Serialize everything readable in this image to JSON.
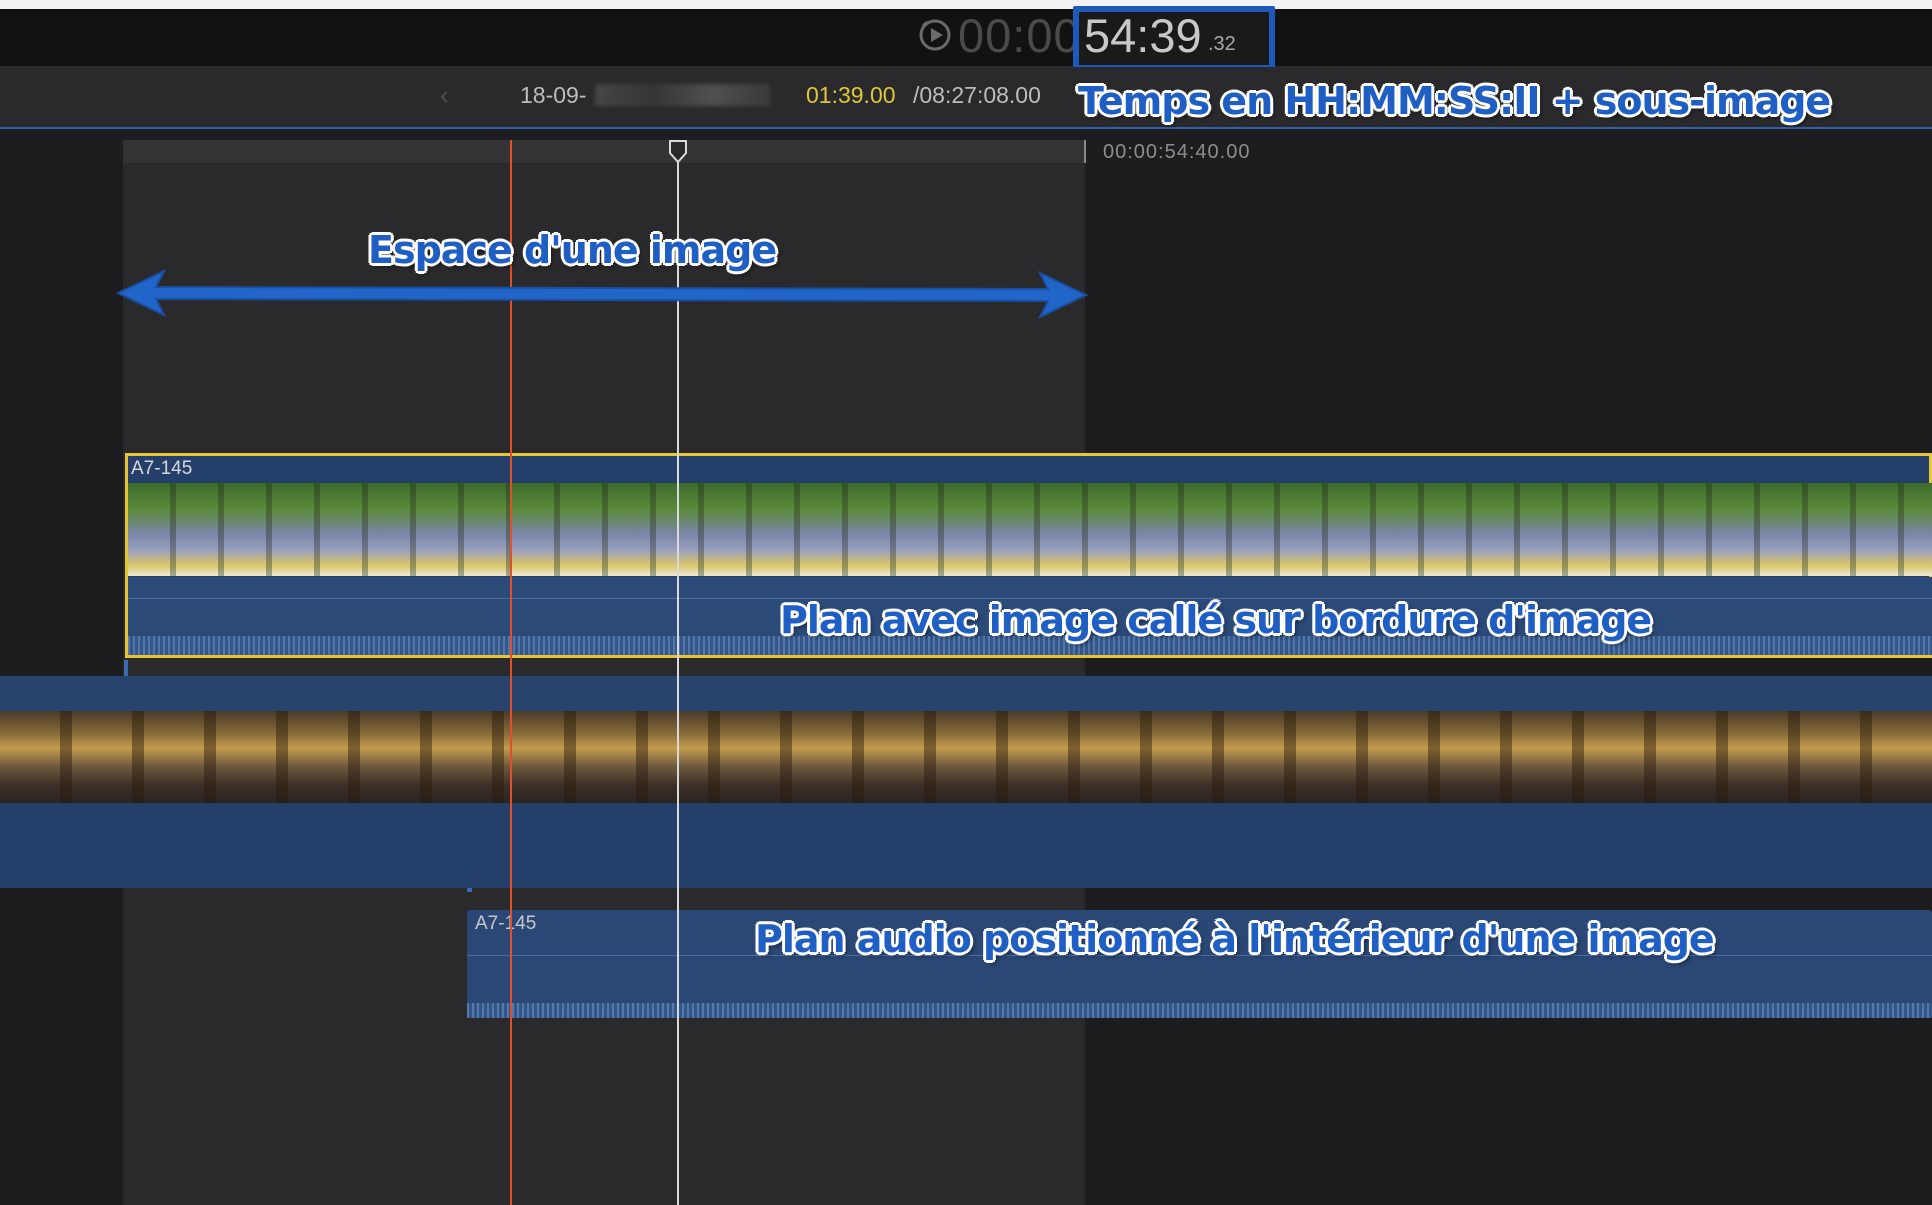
{
  "timecode": {
    "prefix": "00:00",
    "main": "54:39",
    "subframe": ".32",
    "icon": "play-clock-icon"
  },
  "infobar": {
    "back_icon": "chevron-left-icon",
    "back_glyph": "‹",
    "project_name": "18-09-",
    "time_current": "01:39.00",
    "time_total": "/08:27:08.00"
  },
  "ruler": {
    "end_label": "00:00:54:40.00"
  },
  "clips": {
    "video_clip_label": "A7-145",
    "audio_clip_label": "A7-145"
  },
  "annotations": {
    "timecode_format": "Temps en HH:MM:SS:II + sous-image",
    "frame_space": "Espace d'une image",
    "clip_on_frame": "Plan avec image callé sur bordure d'image",
    "audio_in_frame": "Plan audio positionné à l'intérieur d'une image"
  },
  "colors": {
    "accent": "#1f59b8",
    "selection": "#e8c532",
    "skimmer": "#e0502c",
    "current_time": "#e0c63c"
  }
}
